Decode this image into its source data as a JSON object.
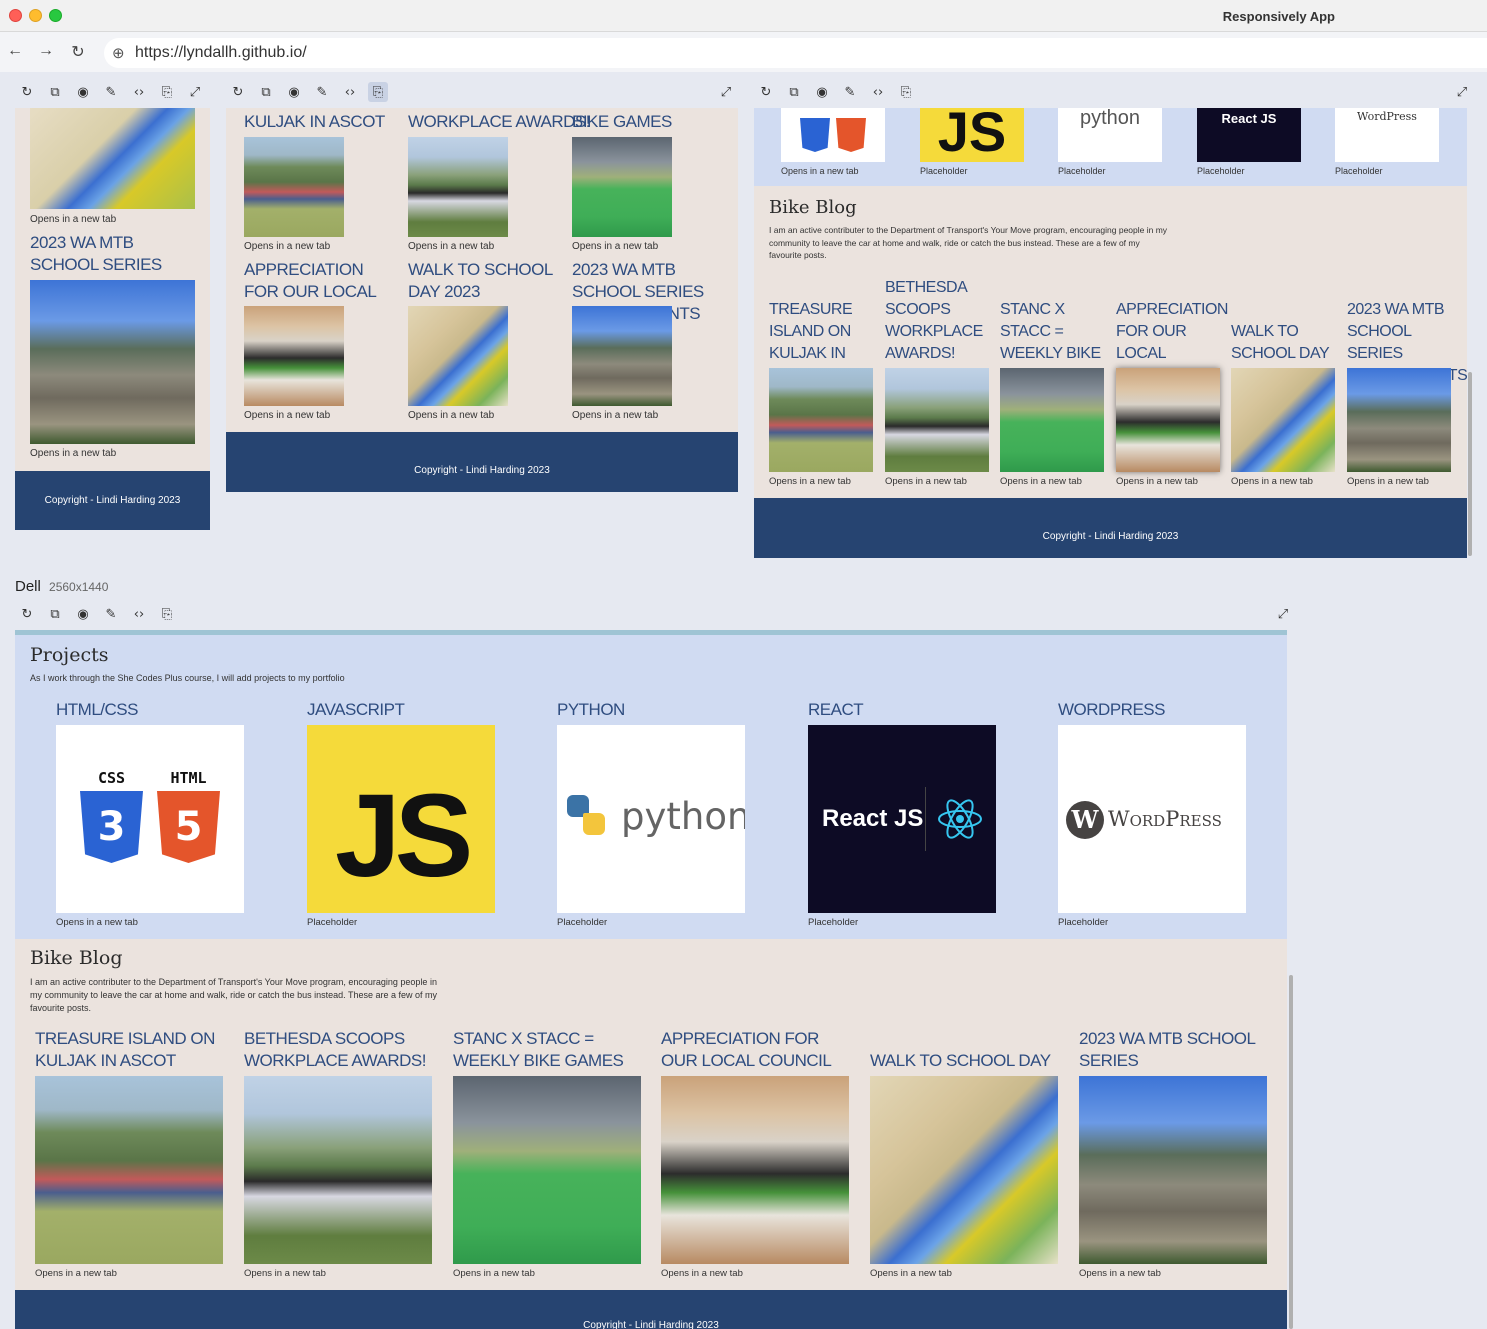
{
  "window": {
    "app_title": "Responsively App"
  },
  "address": {
    "url": "https://lyndallh.github.io/"
  },
  "icons": {
    "back": "arrow-left-icon",
    "forward": "arrow-right-icon",
    "reload": "reload-icon",
    "globe": "globe-icon",
    "screenshot": "camera-icon",
    "inspect": "code-icon",
    "rotate": "rotate-device-icon",
    "expand": "expand-icon"
  },
  "viewport_small": {
    "captions": [
      "Opens in a new tab",
      "Opens in a new tab"
    ],
    "title": "2023 WA MTB SCHOOL SERIES ACHIEVEMENTS",
    "footer": "Copyright - Lindi Harding 2023"
  },
  "viewport_medium": {
    "row1_titles": [
      "KULJAK IN ASCOT",
      "WORKPLACE AWARDS!",
      "BIKE GAMES"
    ],
    "row1_captions": [
      "Opens in a new tab",
      "Opens in a new tab",
      "Opens in a new tab"
    ],
    "row2_titles": [
      "APPRECIATION FOR OUR LOCAL COUNCIL",
      "WALK TO SCHOOL DAY 2023",
      "2023 WA MTB SCHOOL SERIES ACHIEVEMENTS"
    ],
    "row2_captions": [
      "Opens in a new tab",
      "Opens in a new tab",
      "Opens in a new tab"
    ],
    "footer": "Copyright - Lindi Harding 2023"
  },
  "viewport_large": {
    "project_captions": [
      "Opens in a new tab",
      "Placeholder",
      "Placeholder",
      "Placeholder",
      "Placeholder"
    ],
    "project_logos": {
      "js": "JS",
      "python": "python",
      "react": "React JS",
      "wordpress": "WordPress"
    },
    "blog_title": "Bike Blog",
    "blog_intro": "I am an active contributer to the Department of Transport's Your Move program, encouraging people in my community to leave the car at home and walk, ride or catch the bus instead. These are a few of my favourite posts.",
    "posts": [
      {
        "title": "TREASURE ISLAND ON KULJAK IN ASCOT",
        "caption": "Opens in a new tab"
      },
      {
        "title": "BETHESDA SCOOPS WORKPLACE AWARDS!",
        "caption": "Opens in a new tab"
      },
      {
        "title": "STANC X STACC = WEEKLY BIKE GAMES",
        "caption": "Opens in a new tab"
      },
      {
        "title": "APPRECIATION FOR OUR LOCAL COUNCIL",
        "caption": "Opens in a new tab"
      },
      {
        "title": "WALK TO SCHOOL DAY 2023",
        "caption": "Opens in a new tab"
      },
      {
        "title": "2023 WA MTB SCHOOL SERIES ACHIEVEMENTS",
        "caption": "Opens in a new tab"
      }
    ],
    "footer": "Copyright - Lindi Harding 2023"
  },
  "device_dell": {
    "name": "Dell",
    "resolution": "2560x1440",
    "projects_title": "Projects",
    "projects_intro": "As I work through the She Codes Plus course, I will add projects to my portfolio",
    "projects": [
      {
        "title": "HTML/CSS",
        "caption": "Opens in a new tab"
      },
      {
        "title": "JAVASCRIPT",
        "caption": "Placeholder"
      },
      {
        "title": "PYTHON",
        "caption": "Placeholder"
      },
      {
        "title": "REACT",
        "caption": "Placeholder"
      },
      {
        "title": "WORDPRESS",
        "caption": "Placeholder"
      }
    ],
    "logo_text": {
      "css": "CSS",
      "html": "HTML",
      "css_num": "3",
      "html_num": "5",
      "js": "JS",
      "python": "python",
      "react": "React JS",
      "wordpress": "WordPress"
    },
    "blog_title": "Bike Blog",
    "blog_intro": "I am an active contributer to the Department of Transport's Your Move program, encouraging people in my community to leave the car at home and walk, ride or catch the bus instead. These are a few of my favourite posts.",
    "posts": [
      {
        "title": "TREASURE ISLAND ON KULJAK IN ASCOT",
        "caption": "Opens in a new tab"
      },
      {
        "title": "BETHESDA SCOOPS WORKPLACE AWARDS!",
        "caption": "Opens in a new tab"
      },
      {
        "title": "STANC X STACC = WEEKLY BIKE GAMES",
        "caption": "Opens in a new tab"
      },
      {
        "title": "APPRECIATION FOR OUR LOCAL COUNCIL",
        "caption": "Opens in a new tab"
      },
      {
        "title": "WALK TO SCHOOL DAY 2023",
        "caption": "Opens in a new tab"
      },
      {
        "title": "2023 WA MTB SCHOOL SERIES ACHIEVEMENTS",
        "caption": "Opens in a new tab"
      }
    ],
    "footer": "Copyright - Lindi Harding 2023"
  }
}
